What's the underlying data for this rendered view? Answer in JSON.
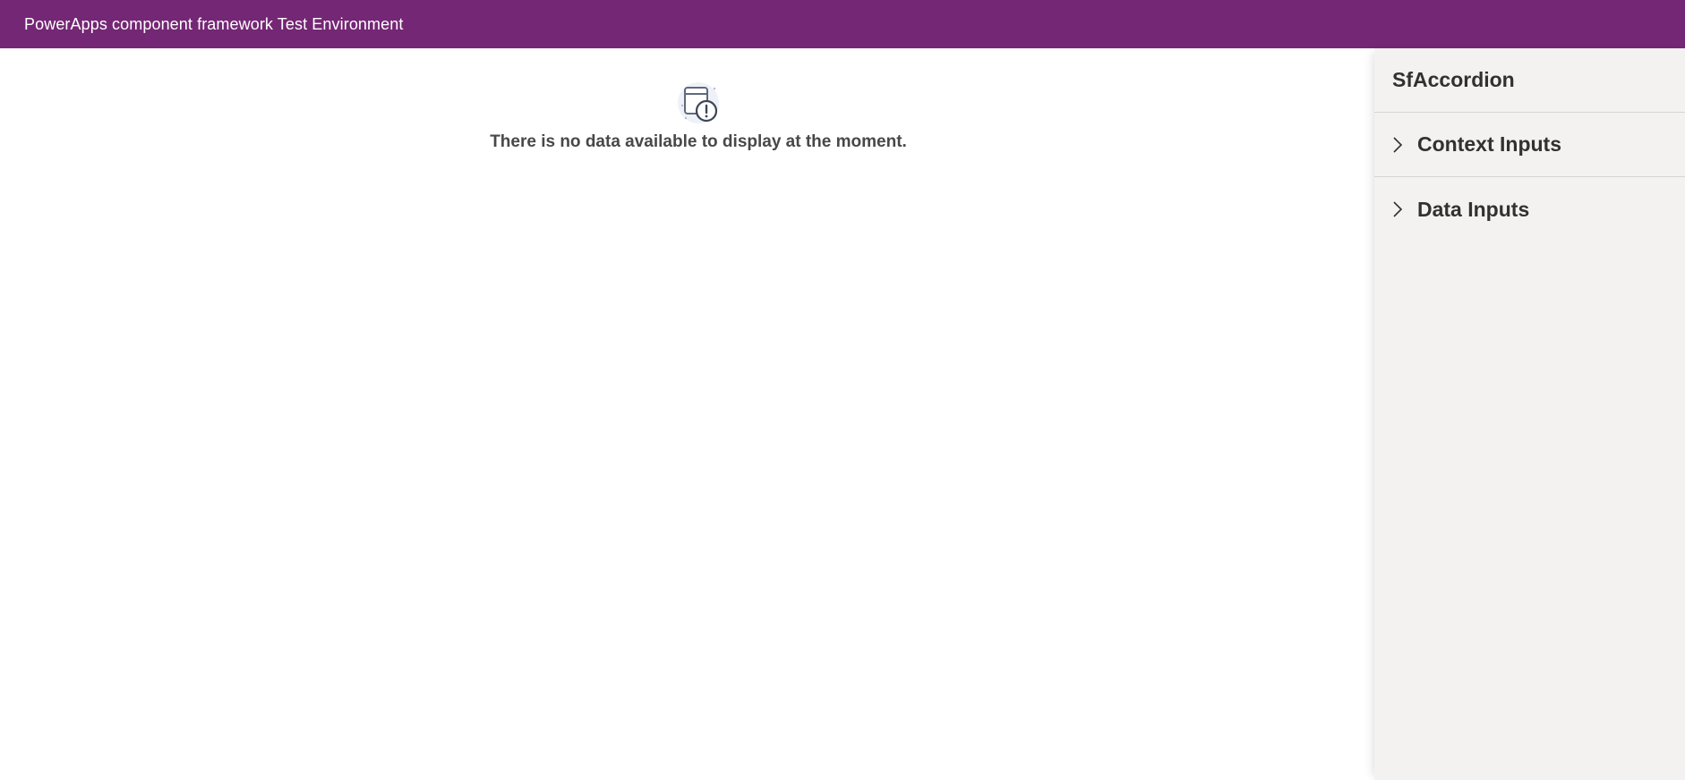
{
  "header": {
    "title": "PowerApps component framework Test Environment",
    "background_color": "#742774"
  },
  "main": {
    "empty_state": {
      "icon": "empty-data-warning-icon",
      "message": "There is no data available to display at the moment."
    }
  },
  "side_panel": {
    "title": "SfAccordion",
    "sections": [
      {
        "label": "Context Inputs",
        "icon": "chevron-right-icon",
        "expanded": false
      },
      {
        "label": "Data Inputs",
        "icon": "chevron-right-icon",
        "expanded": false
      }
    ]
  }
}
